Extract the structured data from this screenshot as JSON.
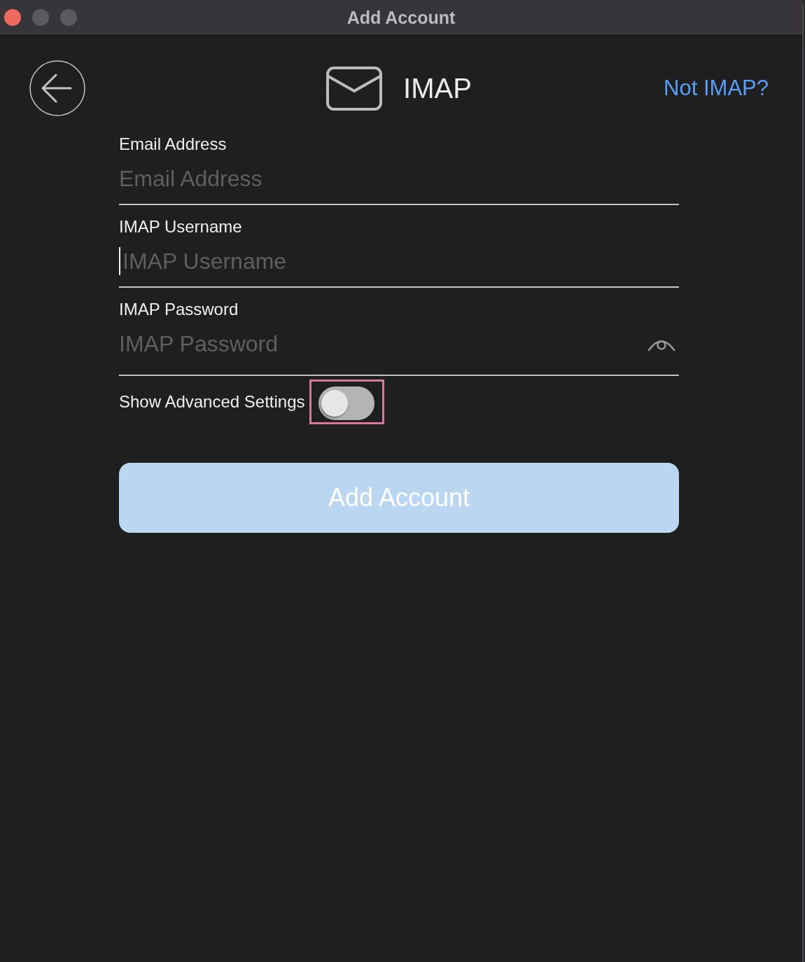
{
  "window": {
    "title": "Add Account",
    "controls": [
      {
        "kind": "close",
        "disabled": false
      },
      {
        "kind": "minimize",
        "disabled": true
      },
      {
        "kind": "zoom",
        "disabled": true
      }
    ]
  },
  "header": {
    "title": "IMAP",
    "switch_link": "Not IMAP?"
  },
  "fields": [
    {
      "kind": "email",
      "label": "Email Address",
      "placeholder": "Email Address",
      "focused": false
    },
    {
      "kind": "text",
      "label": "IMAP Username",
      "placeholder": "IMAP Username",
      "focused": true
    },
    {
      "kind": "password",
      "label": "IMAP Password",
      "placeholder": "IMAP Password",
      "focused": false
    }
  ],
  "advanced_toggle": {
    "label": "Show Advanced Settings",
    "on": false,
    "highlighted": true
  },
  "submit_button": {
    "label": "Add Account",
    "disabled": true
  }
}
